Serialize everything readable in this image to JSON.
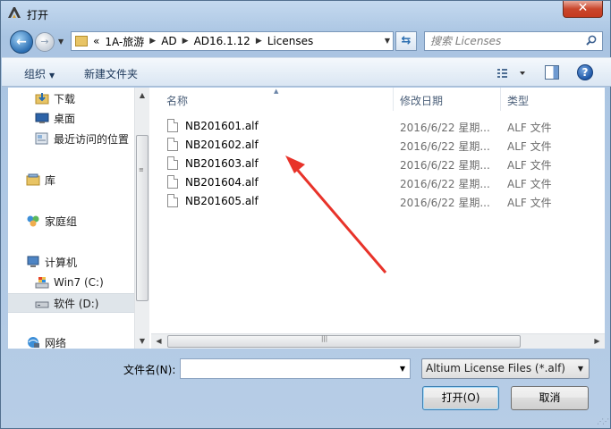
{
  "window": {
    "title": "打开",
    "close_label": "✕"
  },
  "address": {
    "overflow": "«",
    "crumbs": [
      "1A-旅游",
      "AD",
      "AD16.1.12",
      "Licenses"
    ]
  },
  "search": {
    "placeholder": "搜索 Licenses"
  },
  "toolbar": {
    "organize_label": "组织",
    "new_folder_label": "新建文件夹"
  },
  "nav": {
    "items": [
      {
        "label": "下载",
        "icon": "download-folder-icon"
      },
      {
        "label": "桌面",
        "icon": "desktop-icon"
      },
      {
        "label": "最近访问的位置",
        "icon": "recent-places-icon"
      },
      {
        "label": "库",
        "icon": "library-icon"
      },
      {
        "label": "家庭组",
        "icon": "homegroup-icon"
      },
      {
        "label": "计算机",
        "icon": "computer-icon"
      },
      {
        "label": "Win7 (C:)",
        "icon": "system-drive-icon"
      },
      {
        "label": "软件 (D:)",
        "icon": "drive-icon",
        "selected": true
      },
      {
        "label": "网络",
        "icon": "network-icon"
      }
    ]
  },
  "files": {
    "columns": [
      "名称",
      "修改日期",
      "类型"
    ],
    "rows": [
      {
        "name": "NB201601.alf",
        "date": "2016/6/22 星期...",
        "type": "ALF 文件"
      },
      {
        "name": "NB201602.alf",
        "date": "2016/6/22 星期...",
        "type": "ALF 文件"
      },
      {
        "name": "NB201603.alf",
        "date": "2016/6/22 星期...",
        "type": "ALF 文件"
      },
      {
        "name": "NB201604.alf",
        "date": "2016/6/22 星期...",
        "type": "ALF 文件"
      },
      {
        "name": "NB201605.alf",
        "date": "2016/6/22 星期...",
        "type": "ALF 文件"
      }
    ]
  },
  "footer": {
    "filename_label": "文件名(N):",
    "filename_value": "",
    "filter_value": "Altium License Files (*.alf)",
    "open_label": "打开(O)",
    "cancel_label": "取消"
  },
  "colors": {
    "annotation_arrow": "#e8332a",
    "selected_nav": "#dfe5ea"
  }
}
